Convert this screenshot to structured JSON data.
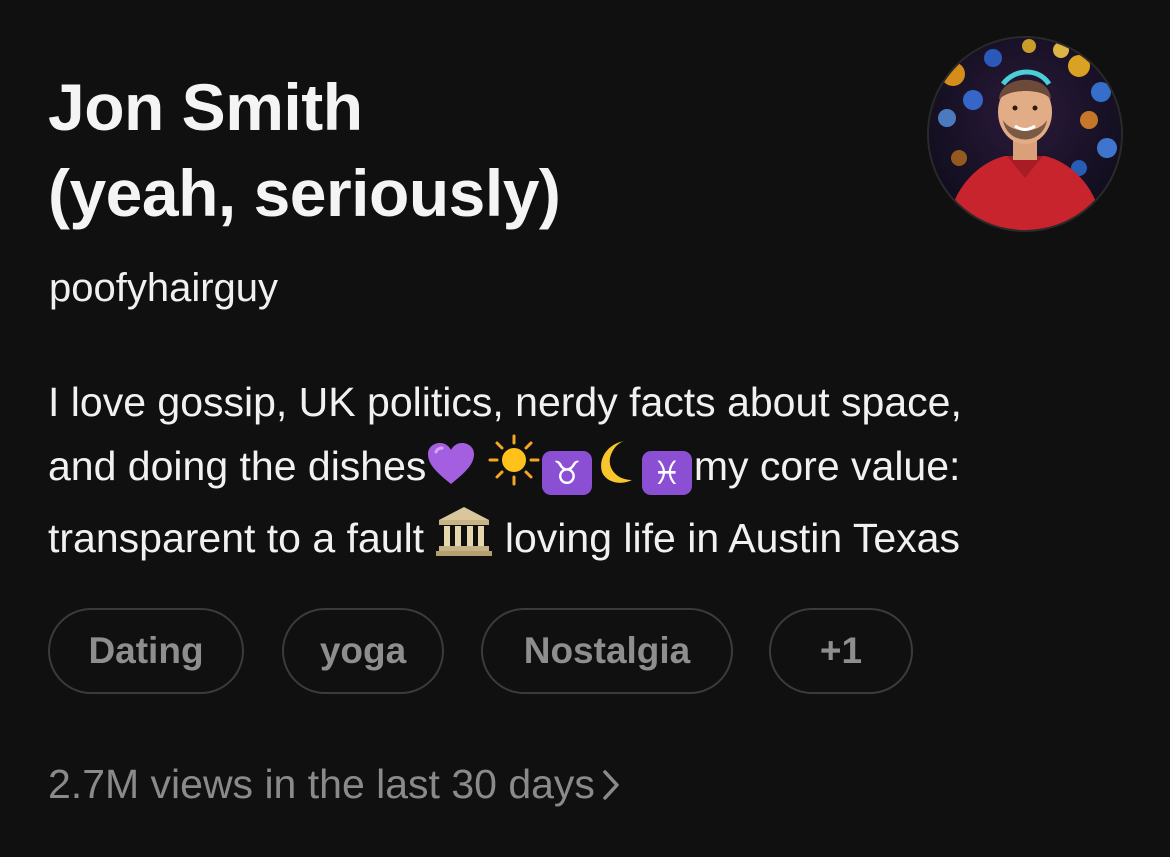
{
  "profile": {
    "name_line1": "Jon Smith",
    "name_line2": "(yeah, seriously)",
    "username": "poofyhairguy",
    "avatar_icon": "profile-photo-man-red-shirt-bokeh-lights"
  },
  "bio": {
    "line1": "I love gossip, UK politics, nerdy facts about space,",
    "line2_text": "and doing the dishes",
    "line2_end": "my core value:",
    "line3_start": "transparent to a fault",
    "line3_end": "loving life in Austin Texas",
    "emoji": {
      "heart": "purple-heart-icon",
      "sun": "sun-icon",
      "taurus": "♉",
      "moon": "crescent-moon-icon",
      "pisces": "♓",
      "building": "classical-building-icon"
    }
  },
  "tags": [
    {
      "label": "Dating"
    },
    {
      "label": "yoga"
    },
    {
      "label": "Nostalgia"
    },
    {
      "label": "+1"
    }
  ],
  "stats": {
    "views_text": "2.7M views in the last 30 days"
  },
  "colors": {
    "background": "#101010",
    "text_primary": "#f3f3f3",
    "text_secondary": "#8a8a8a",
    "tag_border": "#3b3b3b",
    "zodiac_box": "#8b4fd3"
  }
}
